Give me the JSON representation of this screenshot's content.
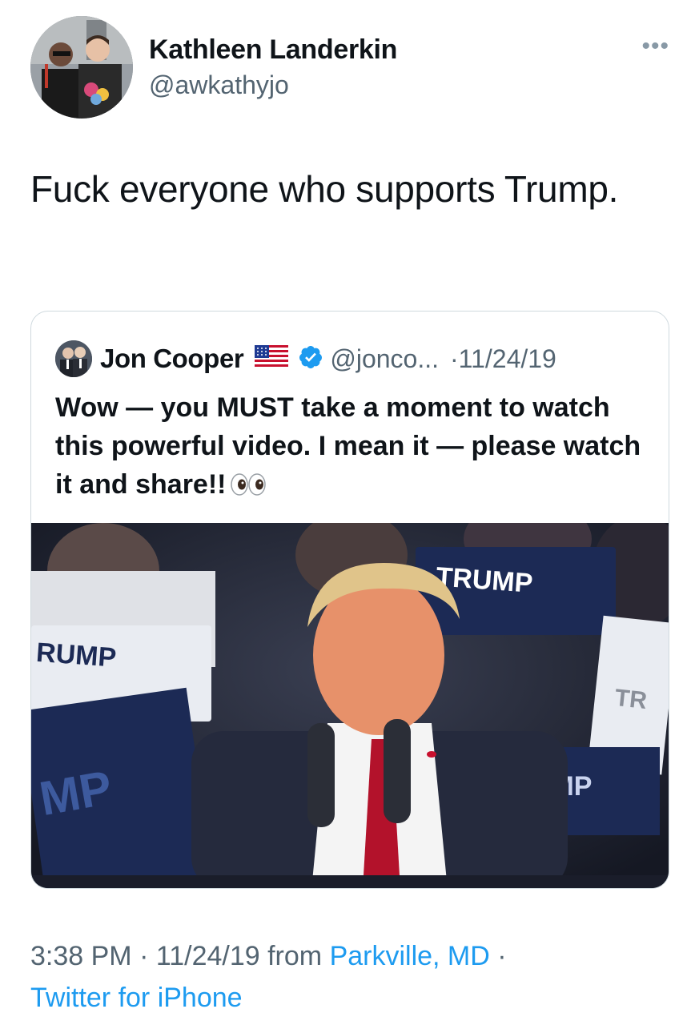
{
  "tweet": {
    "display_name": "Kathleen Landerkin",
    "handle": "@awkathyjo",
    "more_icon": "more-icon",
    "text": "Fuck everyone who supports Trump."
  },
  "quote": {
    "display_name": "Jon Cooper",
    "flag_icon": "us-flag-icon",
    "verified_icon": "verified-badge-icon",
    "handle": "@jonco...",
    "date": "·11/24/19",
    "text": "Wow — you MUST take a moment to watch this powerful video. I mean it — please watch it and share!!",
    "emoji_icon": "eyes-emoji-icon",
    "video_signs": [
      "TRUMP",
      "RUMP",
      "MP",
      "IMP",
      "TR"
    ]
  },
  "meta": {
    "time": "3:38 PM · 11/24/19 from ",
    "location": "Parkville, MD",
    "separator": " · ",
    "source": "Twitter for iPhone"
  },
  "colors": {
    "text": "#0f1419",
    "secondary": "#536471",
    "link": "#1d9bf0",
    "border": "#cfd9de"
  }
}
